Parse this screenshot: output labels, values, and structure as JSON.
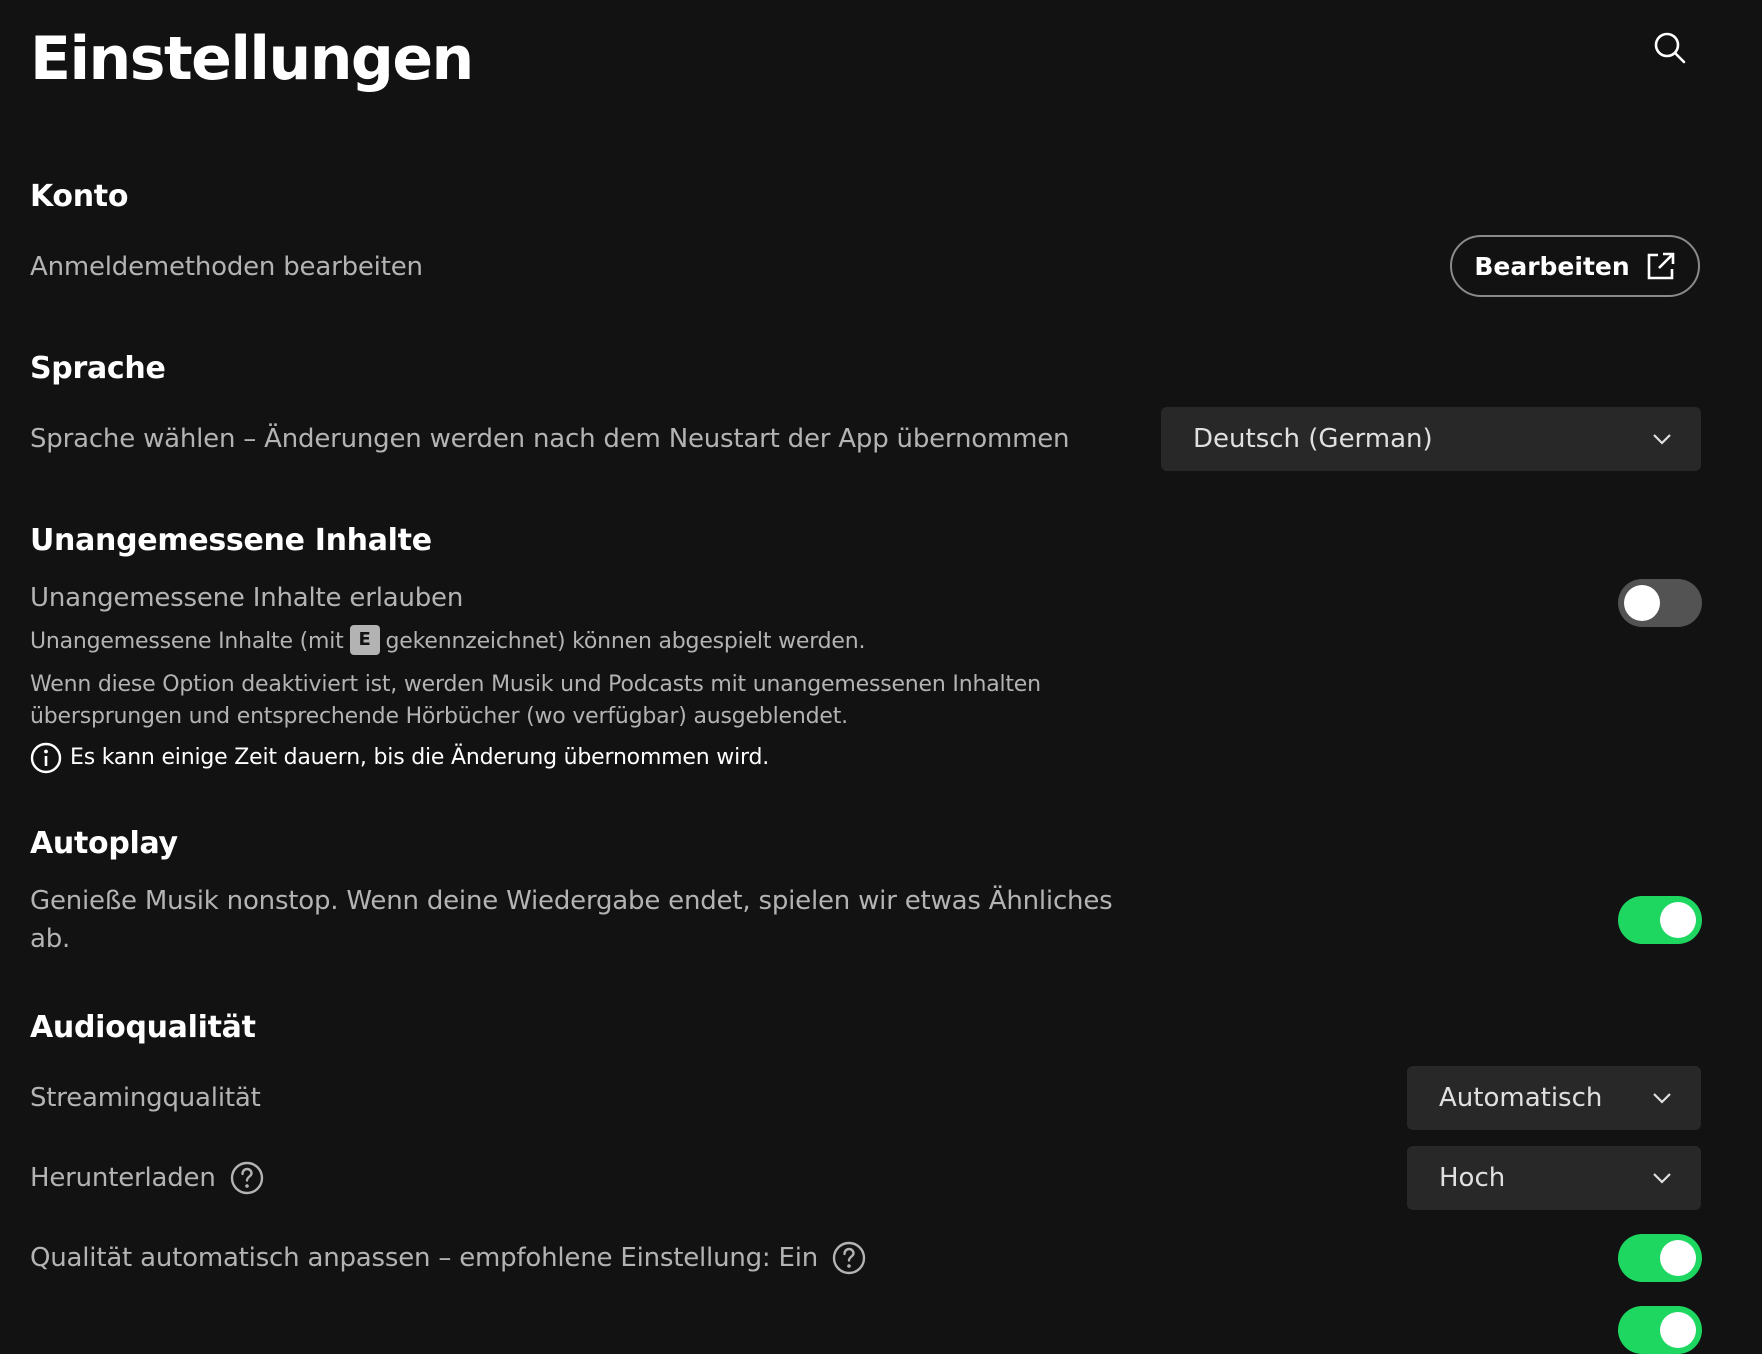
{
  "header": {
    "title": "Einstellungen"
  },
  "account": {
    "title": "Konto",
    "label": "Anmeldemethoden bearbeiten",
    "button_label": "Bearbeiten"
  },
  "language": {
    "title": "Sprache",
    "label": "Sprache wählen – Änderungen werden nach dem Neustart der App übernommen",
    "selected": "Deutsch (German)"
  },
  "explicit": {
    "title": "Unangemessene Inhalte",
    "label": "Unangemessene Inhalte erlauben",
    "desc_before": "Unangemessene Inhalte (mit",
    "badge": "E",
    "desc_after": "gekennzeichnet) können abgespielt werden.",
    "desc_line2": "Wenn diese Option deaktiviert ist, werden Musik und Podcasts mit unangemessenen Inhalten",
    "desc_line3": "übersprungen und entsprechende Hörbücher (wo verfügbar) ausgeblendet.",
    "info": "Es kann einige Zeit dauern, bis die Änderung übernommen wird.",
    "enabled": false
  },
  "autoplay": {
    "title": "Autoplay",
    "label_line1": "Genieße Musik nonstop. Wenn deine Wiedergabe endet, spielen wir etwas Ähnliches",
    "label_line2": "ab.",
    "enabled": true
  },
  "audio": {
    "title": "Audioqualität",
    "streaming_label": "Streamingqualität",
    "streaming_value": "Automatisch",
    "download_label": "Herunterladen",
    "download_value": "Hoch",
    "auto_adjust_label": "Qualität automatisch anpassen – empfohlene Einstellung: Ein",
    "auto_adjust_enabled": true
  },
  "colors": {
    "background": "#121212",
    "accent": "#1ed760",
    "toggle_off": "#535353",
    "dropdown_bg": "#282828",
    "secondary_text": "#b3b3b3"
  }
}
